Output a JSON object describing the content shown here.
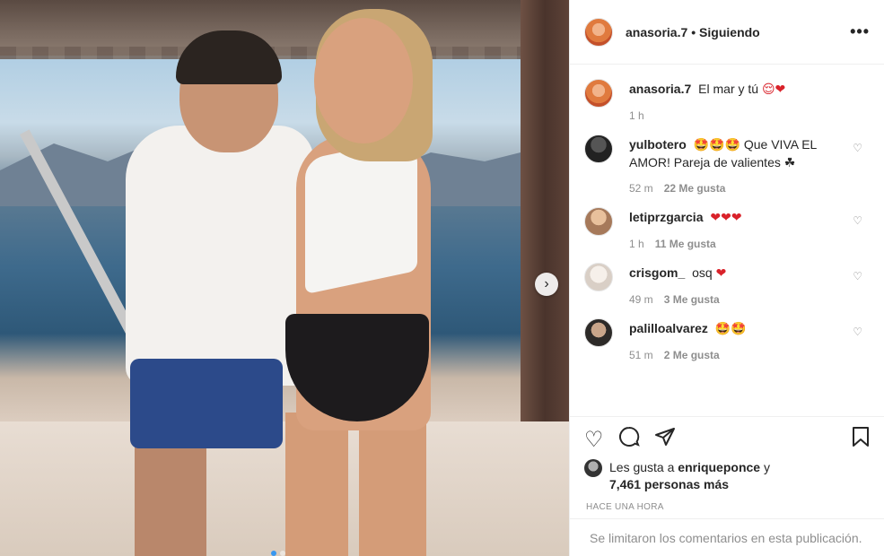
{
  "post": {
    "username": "anasoria.7",
    "following_label": "• Siguiendo",
    "more_icon": "more-horizontal-icon"
  },
  "caption": {
    "username": "anasoria.7",
    "text": "El mar y tú",
    "emoji": "😌❤",
    "time": "1 h"
  },
  "comments": [
    {
      "username": "yulbotero",
      "emoji": "🤩🤩🤩",
      "text": "Que VIVA EL AMOR! Pareja de valientes ☘",
      "time": "52 m",
      "likes": "22 Me gusta"
    },
    {
      "username": "letiprzgarcia",
      "emoji": "❤❤❤",
      "text": "",
      "time": "1 h",
      "likes": "11 Me gusta"
    },
    {
      "username": "crisgom_",
      "emoji": "❤",
      "text": "osq",
      "time": "49 m",
      "likes": "3 Me gusta"
    },
    {
      "username": "palilloalvarez",
      "emoji": "🤩🤩",
      "text": "",
      "time": "51 m",
      "likes": "2 Me gusta"
    }
  ],
  "actions": {
    "like_icon": "heart-outline-icon",
    "comment_icon": "comment-icon",
    "share_icon": "paper-plane-icon",
    "save_icon": "bookmark-icon"
  },
  "likes": {
    "prefix": "Les gusta a",
    "user": "enriqueponce",
    "suffix": "y",
    "count": "7,461 personas más"
  },
  "time_ago": "HACE UNA HORA",
  "comments_limited": "Se limitaron los comentarios en esta publicación.",
  "carousel": {
    "current": 1,
    "total": 2
  }
}
